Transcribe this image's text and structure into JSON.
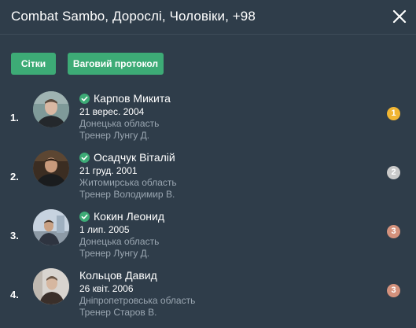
{
  "header": {
    "title": "Combat Sambo, Дорослі, Чоловіки, +98",
    "close_icon": "close-icon"
  },
  "buttons": {
    "grids_label": "Сітки",
    "protocol_label": "Ваговий протокол"
  },
  "colors": {
    "accent": "#3dab76",
    "gold": "#f0b532",
    "silver": "#c9c9c9",
    "bronze": "#d3917c",
    "background": "#2f3d4a"
  },
  "athletes": [
    {
      "rank": "1.",
      "name": "Карпов Микита",
      "verified": true,
      "dob": "21 верес. 2004",
      "region": "Донецька область",
      "coach": "Тренер Лунгу Д.",
      "place": "1",
      "medal": "gold"
    },
    {
      "rank": "2.",
      "name": "Осадчук Віталій",
      "verified": true,
      "dob": "21 груд. 2001",
      "region": "Житомирська область",
      "coach": "Тренер Володимир В.",
      "place": "2",
      "medal": "silver"
    },
    {
      "rank": "3.",
      "name": "Кокин Леонид",
      "verified": true,
      "dob": "1 лип. 2005",
      "region": "Донецька область",
      "coach": "Тренер Лунгу Д.",
      "place": "3",
      "medal": "bronze"
    },
    {
      "rank": "4.",
      "name": "Кольцов Давид",
      "verified": false,
      "dob": "26 квіт. 2006",
      "region": "Дніпропетровська область",
      "coach": "Тренер Старов В.",
      "place": "3",
      "medal": "bronze"
    }
  ]
}
